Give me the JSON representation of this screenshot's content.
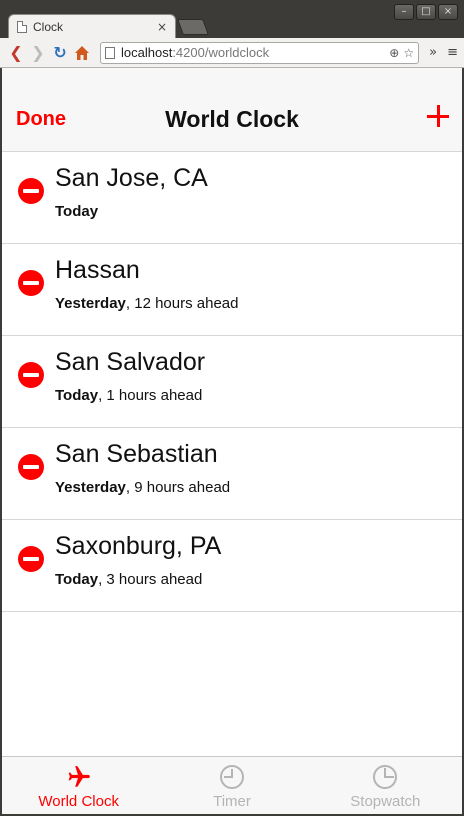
{
  "browser": {
    "tab_title": "Clock",
    "tab_close": "×",
    "url_host": "localhost",
    "url_rest": ":4200/worldclock",
    "window_buttons": [
      "–",
      "□",
      "×"
    ],
    "toolbar_overflow": "»",
    "toolbar_menu": "≡"
  },
  "header": {
    "done_label": "Done",
    "title": "World Clock",
    "add_icon": "plus-icon"
  },
  "clocks": [
    {
      "city": "San Jose, CA",
      "day": "Today",
      "offset": ""
    },
    {
      "city": "Hassan",
      "day": "Yesterday",
      "offset": ", 12 hours ahead"
    },
    {
      "city": "San Salvador",
      "day": "Today",
      "offset": ", 1 hours ahead"
    },
    {
      "city": "San Sebastian",
      "day": "Yesterday",
      "offset": ", 9 hours ahead"
    },
    {
      "city": "Saxonburg, PA",
      "day": "Today",
      "offset": ", 3 hours ahead"
    }
  ],
  "tabbar": {
    "items": [
      {
        "label": "World Clock",
        "icon": "airplane-icon",
        "active": true
      },
      {
        "label": "Timer",
        "icon": "timer-icon",
        "active": false
      },
      {
        "label": "Stopwatch",
        "icon": "stopwatch-icon",
        "active": false
      }
    ]
  },
  "colors": {
    "accent": "#ff0000",
    "inactive_tab": "#b4b4b4"
  }
}
